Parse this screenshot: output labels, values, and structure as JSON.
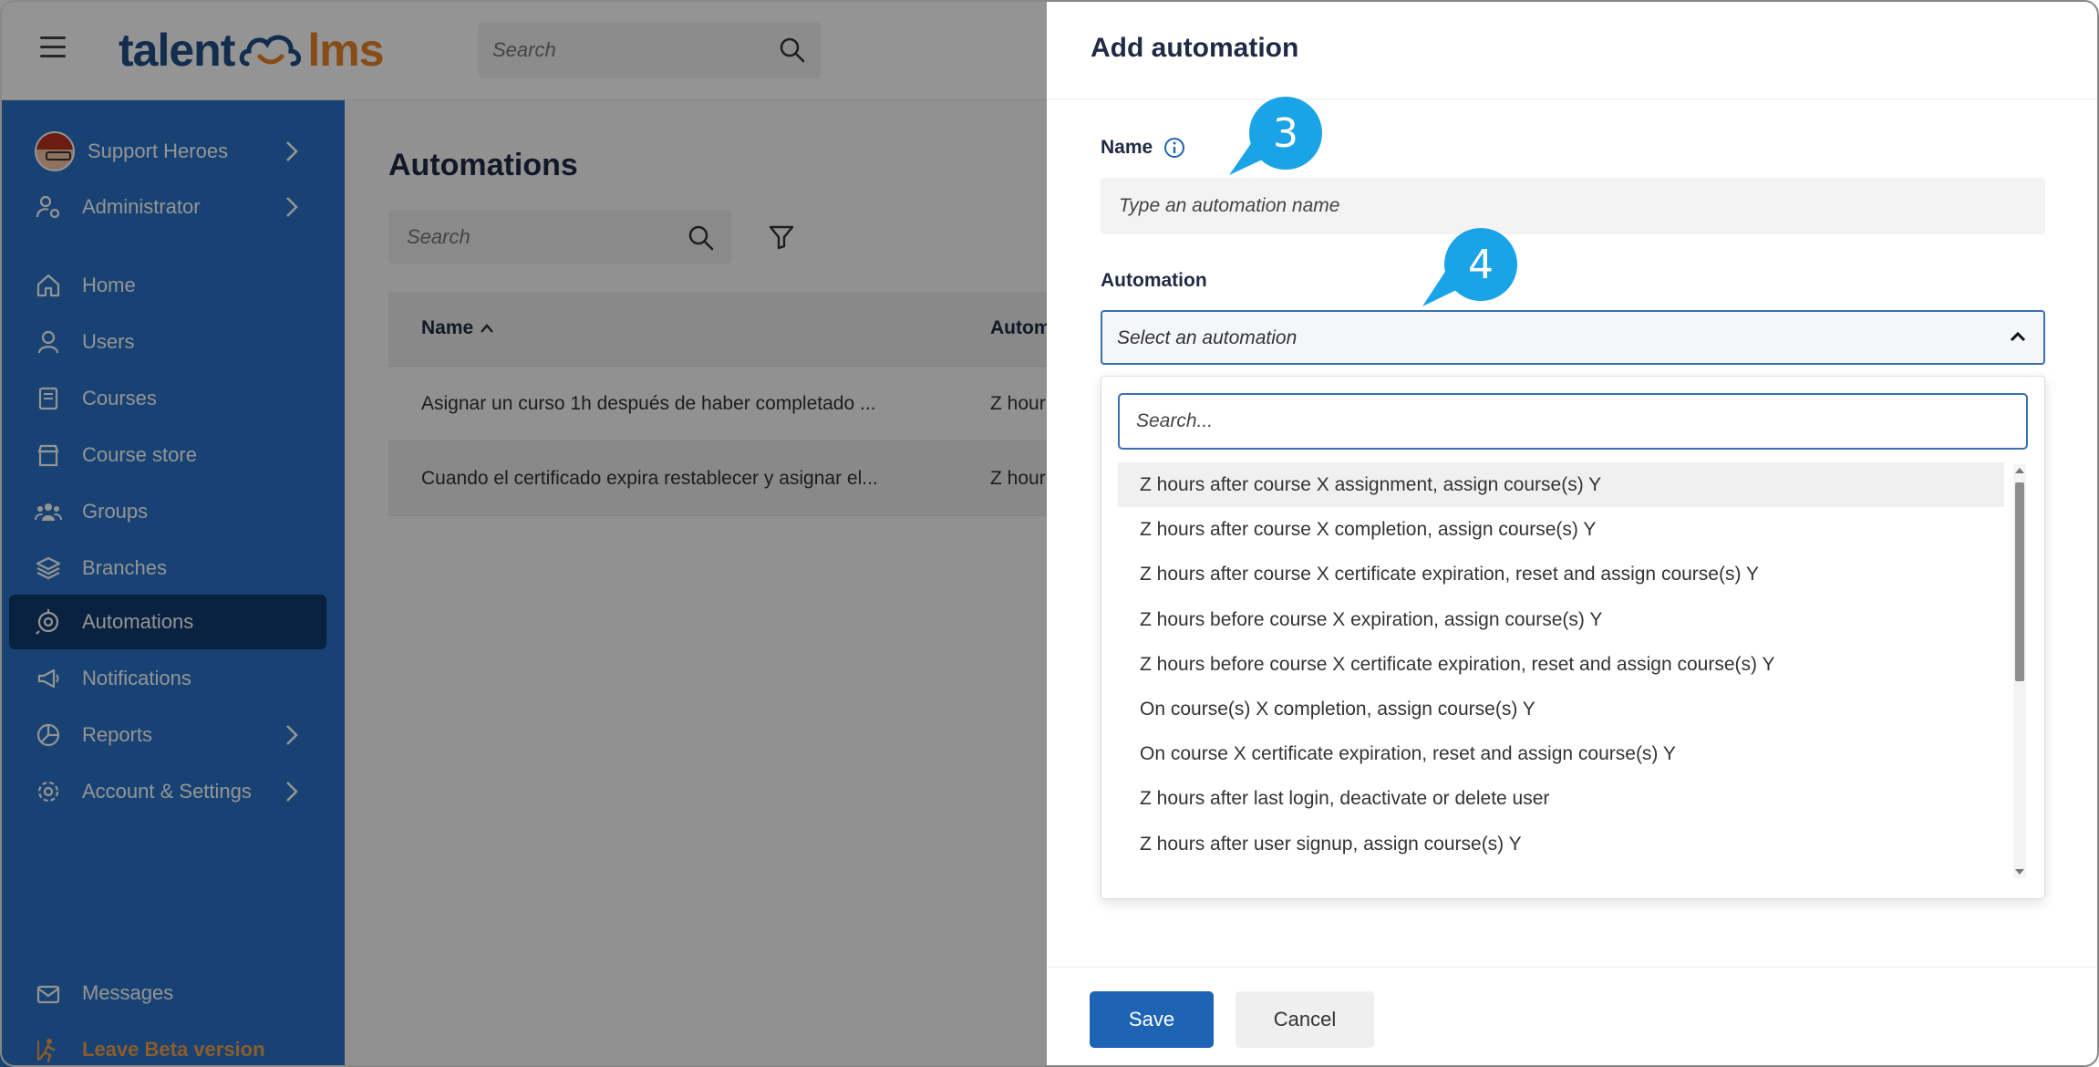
{
  "app": {
    "logo_left": "talent",
    "logo_right": "lms",
    "search_placeholder": "Search"
  },
  "sidebar": {
    "items": [
      {
        "label": "Support Heroes",
        "icon": "avatar"
      },
      {
        "label": "Administrator",
        "icon": "user-gear-icon"
      },
      {
        "label": "Home",
        "icon": "home-icon"
      },
      {
        "label": "Users",
        "icon": "user-icon"
      },
      {
        "label": "Courses",
        "icon": "book-icon"
      },
      {
        "label": "Course store",
        "icon": "store-icon"
      },
      {
        "label": "Groups",
        "icon": "groups-icon"
      },
      {
        "label": "Branches",
        "icon": "layers-icon"
      },
      {
        "label": "Automations",
        "icon": "automation-icon"
      },
      {
        "label": "Notifications",
        "icon": "megaphone-icon"
      },
      {
        "label": "Reports",
        "icon": "pie-chart-icon"
      },
      {
        "label": "Account & Settings",
        "icon": "gear-icon"
      },
      {
        "label": "Messages",
        "icon": "envelope-icon"
      },
      {
        "label": "Leave Beta version",
        "icon": "exit-icon"
      }
    ],
    "active": "Automations"
  },
  "main": {
    "title": "Automations",
    "search_placeholder": "Search",
    "columns": [
      "Name",
      "Autom"
    ],
    "rows": [
      {
        "name": "Asignar un curso 1h después de haber completado ...",
        "automation": "Z hour"
      },
      {
        "name": "Cuando el certificado expira restablecer y asignar el...",
        "automation": "Z hour"
      }
    ]
  },
  "panel": {
    "title": "Add automation",
    "name_label": "Name",
    "name_placeholder": "Type an automation name",
    "automation_label": "Automation",
    "select_placeholder": "Select an automation",
    "dropdown_search_placeholder": "Search...",
    "options": [
      "Z hours after course X assignment, assign course(s) Y",
      "Z hours after course X completion, assign course(s) Y",
      "Z hours after course X certificate expiration, reset and assign course(s) Y",
      "Z hours before course X expiration, assign course(s) Y",
      "Z hours before course X certificate expiration, reset and assign course(s) Y",
      "On course(s) X completion, assign course(s) Y",
      "On course X certificate expiration, reset and assign course(s) Y",
      "Z hours after last login, deactivate or delete user",
      "Z hours after user signup, assign course(s) Y"
    ],
    "save_label": "Save",
    "cancel_label": "Cancel"
  },
  "callouts": {
    "first": "3",
    "second": "4"
  },
  "colors": {
    "sidebar": "#2a73c6",
    "sidebar_active": "#0f3c6e",
    "primary_button": "#1f63b5",
    "callout": "#1ba3e8",
    "beta": "#f0a04a"
  }
}
